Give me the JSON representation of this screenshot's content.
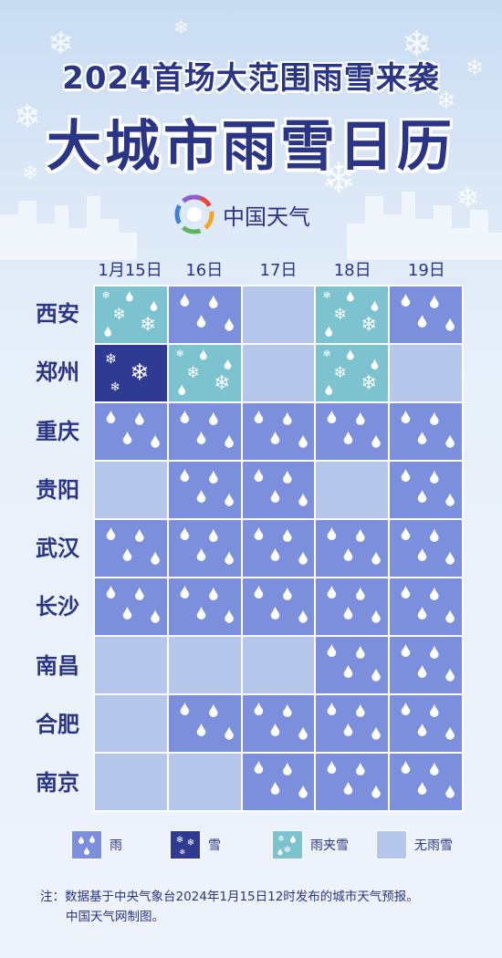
{
  "title": {
    "line1": "2024首场大范围雨雪来袭",
    "line2": "大城市雨雪日历"
  },
  "brand": {
    "name": "中国天气",
    "icon": "china-weather-logo-icon"
  },
  "columns": [
    "1月15日",
    "16日",
    "17日",
    "18日",
    "19日"
  ],
  "rows": [
    {
      "city": "西安",
      "weather": [
        "sleet",
        "rain",
        "none",
        "sleet",
        "rain"
      ]
    },
    {
      "city": "郑州",
      "weather": [
        "snow",
        "sleet",
        "none",
        "sleet",
        "none"
      ]
    },
    {
      "city": "重庆",
      "weather": [
        "rain",
        "rain",
        "rain",
        "rain",
        "rain"
      ]
    },
    {
      "city": "贵阳",
      "weather": [
        "none",
        "rain",
        "rain",
        "none",
        "rain"
      ]
    },
    {
      "city": "武汉",
      "weather": [
        "rain",
        "rain",
        "rain",
        "rain",
        "rain"
      ]
    },
    {
      "city": "长沙",
      "weather": [
        "rain",
        "rain",
        "rain",
        "rain",
        "rain"
      ]
    },
    {
      "city": "南昌",
      "weather": [
        "none",
        "none",
        "none",
        "rain",
        "rain"
      ]
    },
    {
      "city": "合肥",
      "weather": [
        "none",
        "rain",
        "rain",
        "rain",
        "rain"
      ]
    },
    {
      "city": "南京",
      "weather": [
        "none",
        "none",
        "rain",
        "rain",
        "rain"
      ]
    }
  ],
  "legend": [
    {
      "type": "rain",
      "label": "雨"
    },
    {
      "type": "snow",
      "label": "雪"
    },
    {
      "type": "sleet",
      "label": "雨夹雪"
    },
    {
      "type": "none",
      "label": "无雨雪"
    }
  ],
  "colors": {
    "rain": "#7b8fdd",
    "snow": "#2f3b93",
    "sleet": "#7cc3cf",
    "none": "#b5c8ec",
    "text": "#2b3585"
  },
  "note": {
    "line1": "注：数据基于中央气象台2024年1月15日12时发布的城市天气预报。",
    "line2": "中国天气网制图。"
  }
}
